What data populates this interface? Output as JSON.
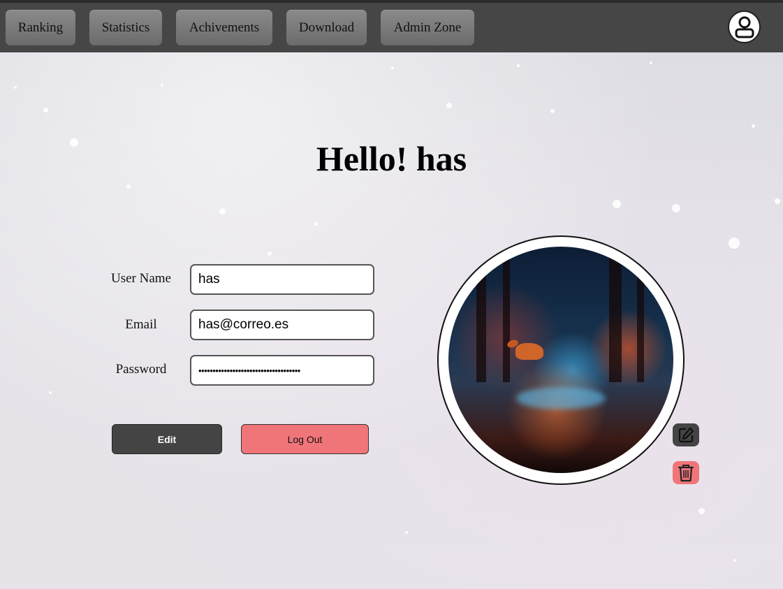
{
  "nav": {
    "items": [
      {
        "label": "Ranking"
      },
      {
        "label": "Statistics"
      },
      {
        "label": "Achivements"
      },
      {
        "label": "Download"
      },
      {
        "label": "Admin Zone"
      }
    ],
    "avatar_icon": "user-icon"
  },
  "greeting": {
    "prefix": "Hello! ",
    "username": "has"
  },
  "form": {
    "username_label": "User Name",
    "username_value": "has",
    "email_label": "Email",
    "email_value": "has@correo.es",
    "password_label": "Password",
    "password_value": "••••••••••••••••••••••••••••••••••••"
  },
  "actions": {
    "edit_label": "Edit",
    "logout_label": "Log Out"
  },
  "profile_photo": {
    "edit_icon": "pencil-square-icon",
    "delete_icon": "trash-icon"
  },
  "colors": {
    "nav_bg": "#464646",
    "nav_button": "#787878",
    "edit_button": "#444444",
    "logout_button": "#f07579"
  }
}
